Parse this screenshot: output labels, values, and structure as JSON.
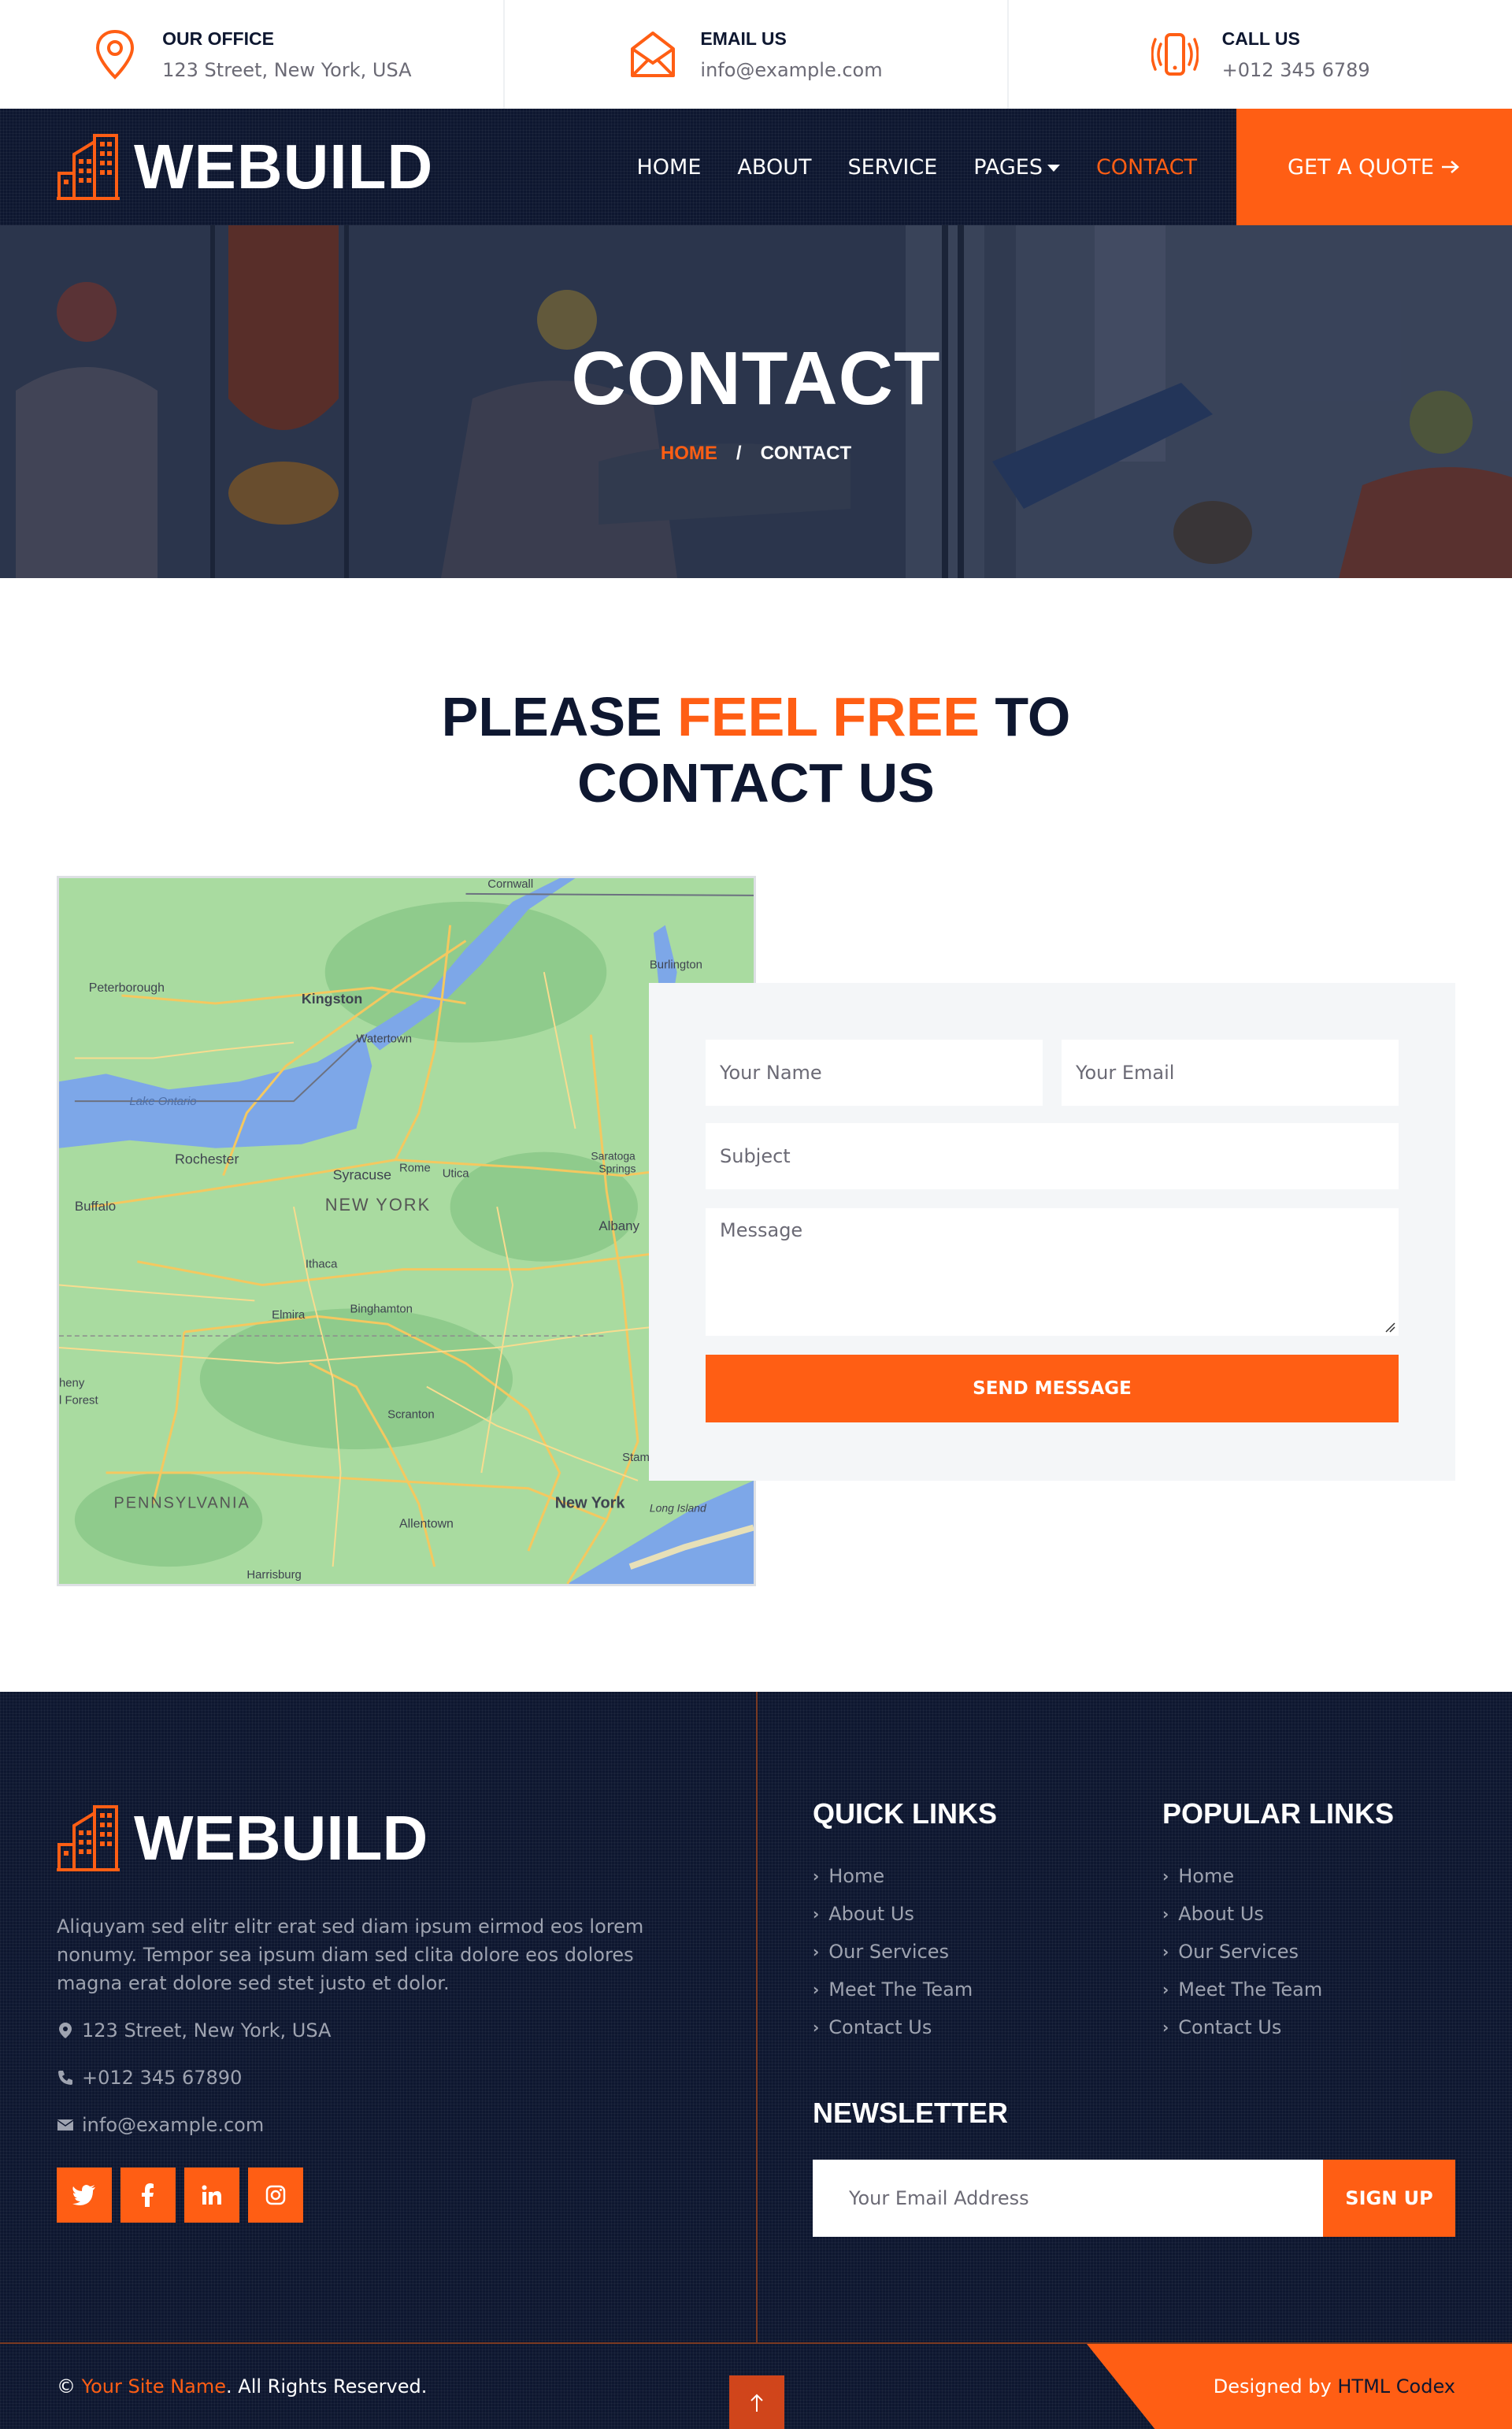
{
  "colors": {
    "accent": "#ff5e14",
    "dark": "#0e1730",
    "muted": "#6b6a75"
  },
  "topbar": [
    {
      "icon": "map-pin-icon",
      "title": "OUR OFFICE",
      "value": "123 Street, New York, USA"
    },
    {
      "icon": "envelope-icon",
      "title": "EMAIL US",
      "value": "info@example.com"
    },
    {
      "icon": "phone-ringing-icon",
      "title": "CALL US",
      "value": "+012 345 6789"
    }
  ],
  "brand": {
    "name": "WEBUILD",
    "icon": "building-icon"
  },
  "nav": {
    "items": [
      "HOME",
      "ABOUT",
      "SERVICE",
      "PAGES",
      "CONTACT"
    ],
    "active": "CONTACT",
    "quote_label": "GET A QUOTE",
    "quote_icon": "arrow-right-icon"
  },
  "hero": {
    "title": "CONTACT",
    "crumb_home": "HOME",
    "crumb_sep": "/",
    "crumb_current": "CONTACT"
  },
  "section": {
    "title_pre": "PLEASE ",
    "title_accent": "FEEL FREE",
    "title_post": " TO",
    "title_line2": "CONTACT US"
  },
  "map": {
    "labels": [
      "Cornwall",
      "Peterborough",
      "Kingston",
      "Watertown",
      "Burlington",
      "Lake Ontario",
      "Rochester",
      "Syracuse",
      "Rome",
      "Utica",
      "Saratoga Springs",
      "Buffalo",
      "NEW YORK",
      "Albany",
      "Ithaca",
      "Elmira",
      "Binghamton",
      "Scranton",
      "PENNSYLVANIA",
      "Allentown",
      "New York",
      "Long Island",
      "Harrisburg",
      "Stam",
      "heny",
      "l Forest"
    ]
  },
  "form": {
    "name_placeholder": "Your Name",
    "email_placeholder": "Your Email",
    "subject_placeholder": "Subject",
    "message_placeholder": "Message",
    "send_label": "SEND MESSAGE"
  },
  "footer": {
    "about": "Aliquyam sed elitr elitr erat sed diam ipsum eirmod eos lorem nonumy. Tempor sea ipsum diam sed clita dolore eos dolores magna erat dolore sed stet justo et dolor.",
    "address": "123 Street, New York, USA",
    "phone": "+012 345 67890",
    "email": "info@example.com",
    "socials": [
      "twitter-icon",
      "facebook-icon",
      "linkedin-icon",
      "instagram-icon"
    ],
    "quick_links_title": "QUICK LINKS",
    "quick_links": [
      "Home",
      "About Us",
      "Our Services",
      "Meet The Team",
      "Contact Us"
    ],
    "popular_links_title": "POPULAR LINKS",
    "popular_links": [
      "Home",
      "About Us",
      "Our Services",
      "Meet The Team",
      "Contact Us"
    ],
    "newsletter_title": "NEWSLETTER",
    "newsletter_placeholder": "Your Email Address",
    "newsletter_button": "SIGN UP",
    "copyright_pre": "© ",
    "site_name": "Your Site Name",
    "copyright_post": ". All Rights Reserved.",
    "designed_pre": "Designed by ",
    "designed_by": "HTML Codex",
    "back_to_top_icon": "arrow-up-icon"
  }
}
